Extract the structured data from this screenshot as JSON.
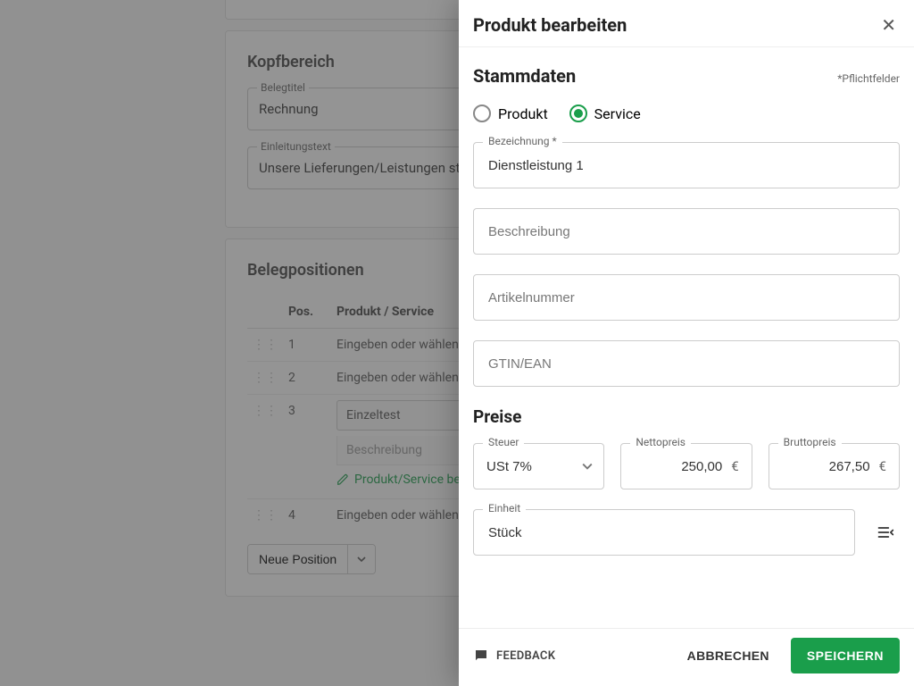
{
  "bg": {
    "kopfbereich": {
      "title": "Kopfbereich",
      "belegtitel_label": "Belegtitel",
      "belegtitel_value": "Rechnung",
      "einleitung_label": "Einleitungstext",
      "einleitung_value": "Unsere Lieferungen/Leistungen stelle"
    },
    "positions": {
      "title": "Belegpositionen",
      "col_pos": "Pos.",
      "col_prod": "Produkt / Service",
      "rows": [
        {
          "pos": "1",
          "text": "Eingeben oder wählen"
        },
        {
          "pos": "2",
          "text": "Eingeben oder wählen"
        },
        {
          "pos": "3",
          "text": "Einzeltest"
        },
        {
          "pos": "4",
          "text": "Eingeben oder wählen"
        }
      ],
      "row3_desc_placeholder": "Beschreibung",
      "row3_edit": "Produkt/Service bearbeite",
      "neu": "Neue Position"
    }
  },
  "drawer": {
    "title": "Produkt bearbeiten",
    "stammdaten": "Stammdaten",
    "pflicht": "*Pflichtfelder",
    "radio_produkt": "Produkt",
    "radio_service": "Service",
    "bezeichnung_label": "Bezeichnung *",
    "bezeichnung_value": "Dienstleistung 1",
    "beschreibung_ph": "Beschreibung",
    "artnr_ph": "Artikelnummer",
    "gtin_ph": "GTIN/EAN",
    "preise": "Preise",
    "steuer_label": "Steuer",
    "steuer_value": "USt 7%",
    "netto_label": "Nettopreis",
    "netto_value": "250,00",
    "brutto_label": "Bruttopreis",
    "brutto_value": "267,50",
    "currency": "€",
    "einheit_label": "Einheit",
    "einheit_value": "Stück"
  },
  "footer": {
    "feedback": "FEEDBACK",
    "cancel": "ABBRECHEN",
    "save": "SPEICHERN"
  }
}
